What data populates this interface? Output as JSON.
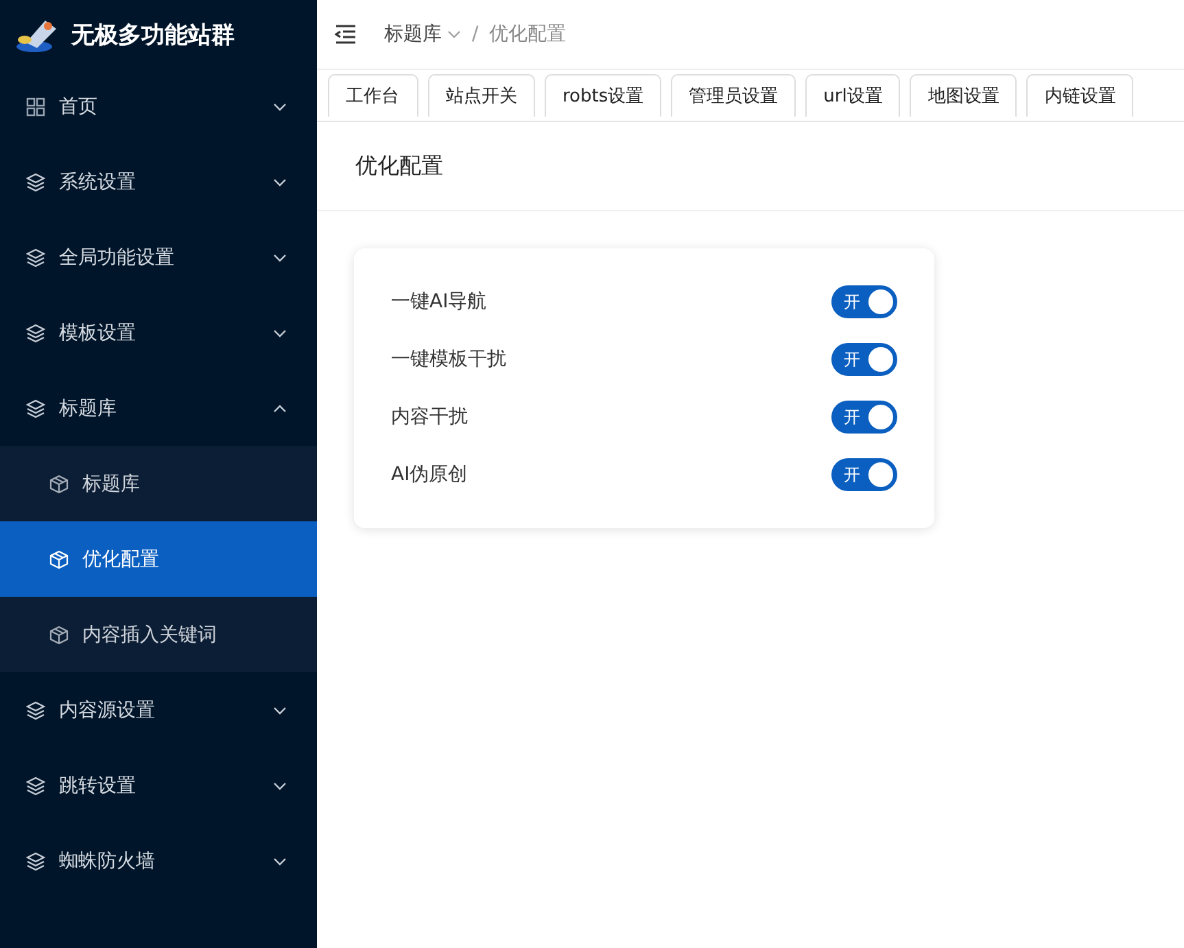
{
  "sidebar": {
    "title": "无极多功能站群",
    "items": [
      {
        "label": "首页",
        "expanded": false
      },
      {
        "label": "系统设置",
        "expanded": false
      },
      {
        "label": "全局功能设置",
        "expanded": false
      },
      {
        "label": "模板设置",
        "expanded": false
      },
      {
        "label": "标题库",
        "expanded": true,
        "children": [
          {
            "label": "标题库",
            "selected": false
          },
          {
            "label": "优化配置",
            "selected": true
          },
          {
            "label": "内容插入关键词",
            "selected": false
          }
        ]
      },
      {
        "label": "内容源设置",
        "expanded": false
      },
      {
        "label": "跳转设置",
        "expanded": false
      },
      {
        "label": "蜘蛛防火墙",
        "expanded": false
      }
    ]
  },
  "breadcrumb": {
    "items": [
      "标题库",
      "优化配置"
    ],
    "separator": "/"
  },
  "tabs": [
    "工作台",
    "站点开关",
    "robts设置",
    "管理员设置",
    "url设置",
    "地图设置",
    "内链设置"
  ],
  "page_title": "优化配置",
  "settings": [
    {
      "label": "一键AI导航",
      "on": true,
      "switch_text": "开"
    },
    {
      "label": "一键模板干扰",
      "on": true,
      "switch_text": "开"
    },
    {
      "label": "内容干扰",
      "on": true,
      "switch_text": "开"
    },
    {
      "label": "AI伪原创",
      "on": true,
      "switch_text": "开"
    }
  ]
}
